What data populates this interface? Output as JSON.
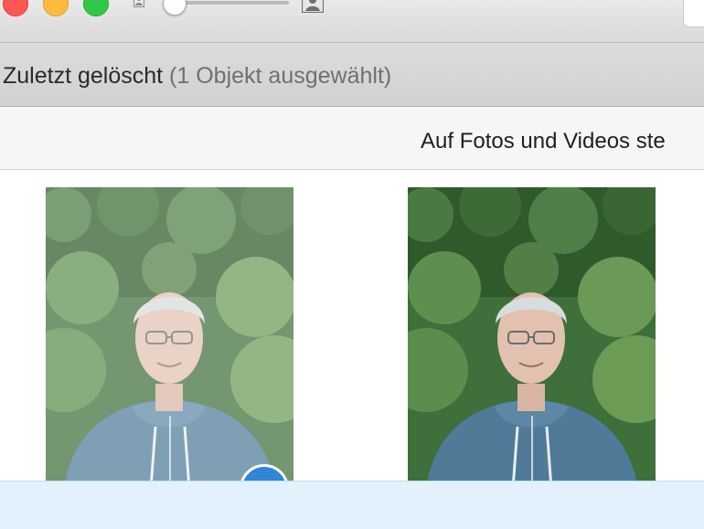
{
  "window": {
    "traffic_lights": [
      {
        "name": "close",
        "color": "#fc5753"
      },
      {
        "name": "minimize",
        "color": "#fdbc40"
      },
      {
        "name": "zoom",
        "color": "#33c748"
      }
    ],
    "zoom_slider": {
      "value": 0.0,
      "min_icon": "small-portrait-icon",
      "max_icon": "large-portrait-icon"
    }
  },
  "header": {
    "title": "Zuletzt gelöscht",
    "selection_info": "(1 Objekt ausgewählt)"
  },
  "infobar": {
    "text": "Auf Fotos und Videos ste"
  },
  "photos": [
    {
      "state": "selected",
      "description_icon": "portrait-photo"
    },
    {
      "state": "unselected",
      "description_icon": "portrait-photo"
    }
  ],
  "colors": {
    "accent": "#2f86d6",
    "bottom_bar": "#e2f1fb"
  }
}
